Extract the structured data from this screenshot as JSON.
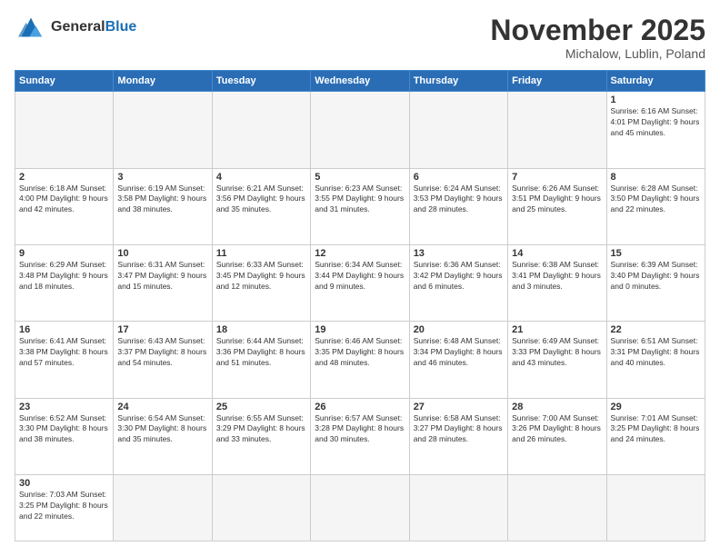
{
  "header": {
    "logo_line1": "General",
    "logo_line2": "Blue",
    "month": "November 2025",
    "location": "Michalow, Lublin, Poland"
  },
  "days_of_week": [
    "Sunday",
    "Monday",
    "Tuesday",
    "Wednesday",
    "Thursday",
    "Friday",
    "Saturday"
  ],
  "weeks": [
    [
      {
        "day": "",
        "info": ""
      },
      {
        "day": "",
        "info": ""
      },
      {
        "day": "",
        "info": ""
      },
      {
        "day": "",
        "info": ""
      },
      {
        "day": "",
        "info": ""
      },
      {
        "day": "",
        "info": ""
      },
      {
        "day": "1",
        "info": "Sunrise: 6:16 AM\nSunset: 4:01 PM\nDaylight: 9 hours\nand 45 minutes."
      }
    ],
    [
      {
        "day": "2",
        "info": "Sunrise: 6:18 AM\nSunset: 4:00 PM\nDaylight: 9 hours\nand 42 minutes."
      },
      {
        "day": "3",
        "info": "Sunrise: 6:19 AM\nSunset: 3:58 PM\nDaylight: 9 hours\nand 38 minutes."
      },
      {
        "day": "4",
        "info": "Sunrise: 6:21 AM\nSunset: 3:56 PM\nDaylight: 9 hours\nand 35 minutes."
      },
      {
        "day": "5",
        "info": "Sunrise: 6:23 AM\nSunset: 3:55 PM\nDaylight: 9 hours\nand 31 minutes."
      },
      {
        "day": "6",
        "info": "Sunrise: 6:24 AM\nSunset: 3:53 PM\nDaylight: 9 hours\nand 28 minutes."
      },
      {
        "day": "7",
        "info": "Sunrise: 6:26 AM\nSunset: 3:51 PM\nDaylight: 9 hours\nand 25 minutes."
      },
      {
        "day": "8",
        "info": "Sunrise: 6:28 AM\nSunset: 3:50 PM\nDaylight: 9 hours\nand 22 minutes."
      }
    ],
    [
      {
        "day": "9",
        "info": "Sunrise: 6:29 AM\nSunset: 3:48 PM\nDaylight: 9 hours\nand 18 minutes."
      },
      {
        "day": "10",
        "info": "Sunrise: 6:31 AM\nSunset: 3:47 PM\nDaylight: 9 hours\nand 15 minutes."
      },
      {
        "day": "11",
        "info": "Sunrise: 6:33 AM\nSunset: 3:45 PM\nDaylight: 9 hours\nand 12 minutes."
      },
      {
        "day": "12",
        "info": "Sunrise: 6:34 AM\nSunset: 3:44 PM\nDaylight: 9 hours\nand 9 minutes."
      },
      {
        "day": "13",
        "info": "Sunrise: 6:36 AM\nSunset: 3:42 PM\nDaylight: 9 hours\nand 6 minutes."
      },
      {
        "day": "14",
        "info": "Sunrise: 6:38 AM\nSunset: 3:41 PM\nDaylight: 9 hours\nand 3 minutes."
      },
      {
        "day": "15",
        "info": "Sunrise: 6:39 AM\nSunset: 3:40 PM\nDaylight: 9 hours\nand 0 minutes."
      }
    ],
    [
      {
        "day": "16",
        "info": "Sunrise: 6:41 AM\nSunset: 3:38 PM\nDaylight: 8 hours\nand 57 minutes."
      },
      {
        "day": "17",
        "info": "Sunrise: 6:43 AM\nSunset: 3:37 PM\nDaylight: 8 hours\nand 54 minutes."
      },
      {
        "day": "18",
        "info": "Sunrise: 6:44 AM\nSunset: 3:36 PM\nDaylight: 8 hours\nand 51 minutes."
      },
      {
        "day": "19",
        "info": "Sunrise: 6:46 AM\nSunset: 3:35 PM\nDaylight: 8 hours\nand 48 minutes."
      },
      {
        "day": "20",
        "info": "Sunrise: 6:48 AM\nSunset: 3:34 PM\nDaylight: 8 hours\nand 46 minutes."
      },
      {
        "day": "21",
        "info": "Sunrise: 6:49 AM\nSunset: 3:33 PM\nDaylight: 8 hours\nand 43 minutes."
      },
      {
        "day": "22",
        "info": "Sunrise: 6:51 AM\nSunset: 3:31 PM\nDaylight: 8 hours\nand 40 minutes."
      }
    ],
    [
      {
        "day": "23",
        "info": "Sunrise: 6:52 AM\nSunset: 3:30 PM\nDaylight: 8 hours\nand 38 minutes."
      },
      {
        "day": "24",
        "info": "Sunrise: 6:54 AM\nSunset: 3:30 PM\nDaylight: 8 hours\nand 35 minutes."
      },
      {
        "day": "25",
        "info": "Sunrise: 6:55 AM\nSunset: 3:29 PM\nDaylight: 8 hours\nand 33 minutes."
      },
      {
        "day": "26",
        "info": "Sunrise: 6:57 AM\nSunset: 3:28 PM\nDaylight: 8 hours\nand 30 minutes."
      },
      {
        "day": "27",
        "info": "Sunrise: 6:58 AM\nSunset: 3:27 PM\nDaylight: 8 hours\nand 28 minutes."
      },
      {
        "day": "28",
        "info": "Sunrise: 7:00 AM\nSunset: 3:26 PM\nDaylight: 8 hours\nand 26 minutes."
      },
      {
        "day": "29",
        "info": "Sunrise: 7:01 AM\nSunset: 3:25 PM\nDaylight: 8 hours\nand 24 minutes."
      }
    ],
    [
      {
        "day": "30",
        "info": "Sunrise: 7:03 AM\nSunset: 3:25 PM\nDaylight: 8 hours\nand 22 minutes."
      },
      {
        "day": "",
        "info": ""
      },
      {
        "day": "",
        "info": ""
      },
      {
        "day": "",
        "info": ""
      },
      {
        "day": "",
        "info": ""
      },
      {
        "day": "",
        "info": ""
      },
      {
        "day": "",
        "info": ""
      }
    ]
  ]
}
